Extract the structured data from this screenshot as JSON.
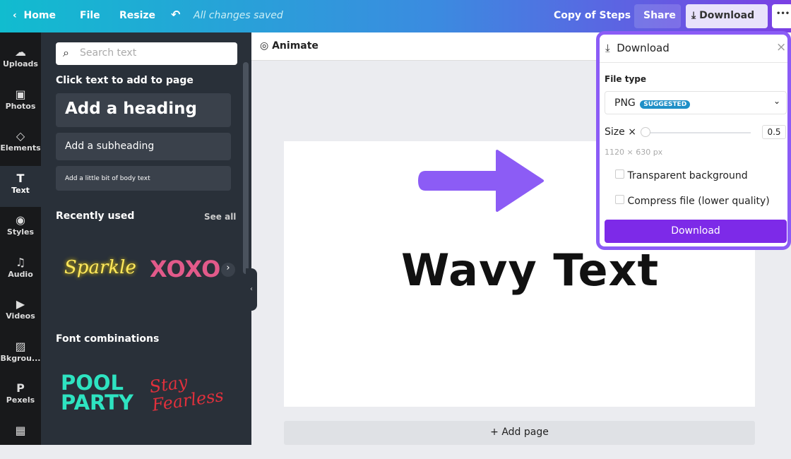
{
  "topbar": {
    "home": "Home",
    "file": "File",
    "resize": "Resize",
    "status": "All changes saved",
    "title": "Copy of Steps",
    "share": "Share",
    "download": "Download",
    "more": "•••"
  },
  "rail": [
    {
      "label": "Uploads",
      "icon": "☁"
    },
    {
      "label": "Photos",
      "icon": "▣"
    },
    {
      "label": "Elements",
      "icon": "◇"
    },
    {
      "label": "Text",
      "icon": "T"
    },
    {
      "label": "Styles",
      "icon": "◉"
    },
    {
      "label": "Audio",
      "icon": "♫"
    },
    {
      "label": "Videos",
      "icon": "▶"
    },
    {
      "label": "Bkgrou...",
      "icon": "▨"
    },
    {
      "label": "Pexels",
      "icon": "P"
    },
    {
      "label": "",
      "icon": "▦"
    }
  ],
  "panel": {
    "search_placeholder": "Search text",
    "click_title": "Click text to add to page",
    "heading": "Add a heading",
    "subheading": "Add a subheading",
    "body": "Add a little bit of body text",
    "recent": "Recently used",
    "see_all": "See all",
    "recent_items": [
      "Sparkle",
      "XOXO"
    ],
    "font_combos": "Font combinations",
    "combo_items": [
      "POOL PARTY",
      "Stay Fearless"
    ]
  },
  "toolbar": {
    "animate": "Animate"
  },
  "canvas": {
    "text": "Wavy Text",
    "add_page": "+ Add page",
    "arrow_color": "#8c5cf5"
  },
  "download_panel": {
    "title": "Download",
    "file_type_label": "File type",
    "file_type": "PNG",
    "badge": "SUGGESTED",
    "size_label": "Size ×",
    "size_value": "0.5",
    "dimensions": "1120 × 630 px",
    "transparent": "Transparent background",
    "compress": "Compress file (lower quality)",
    "button": "Download",
    "accent": "#7d2ae8"
  }
}
